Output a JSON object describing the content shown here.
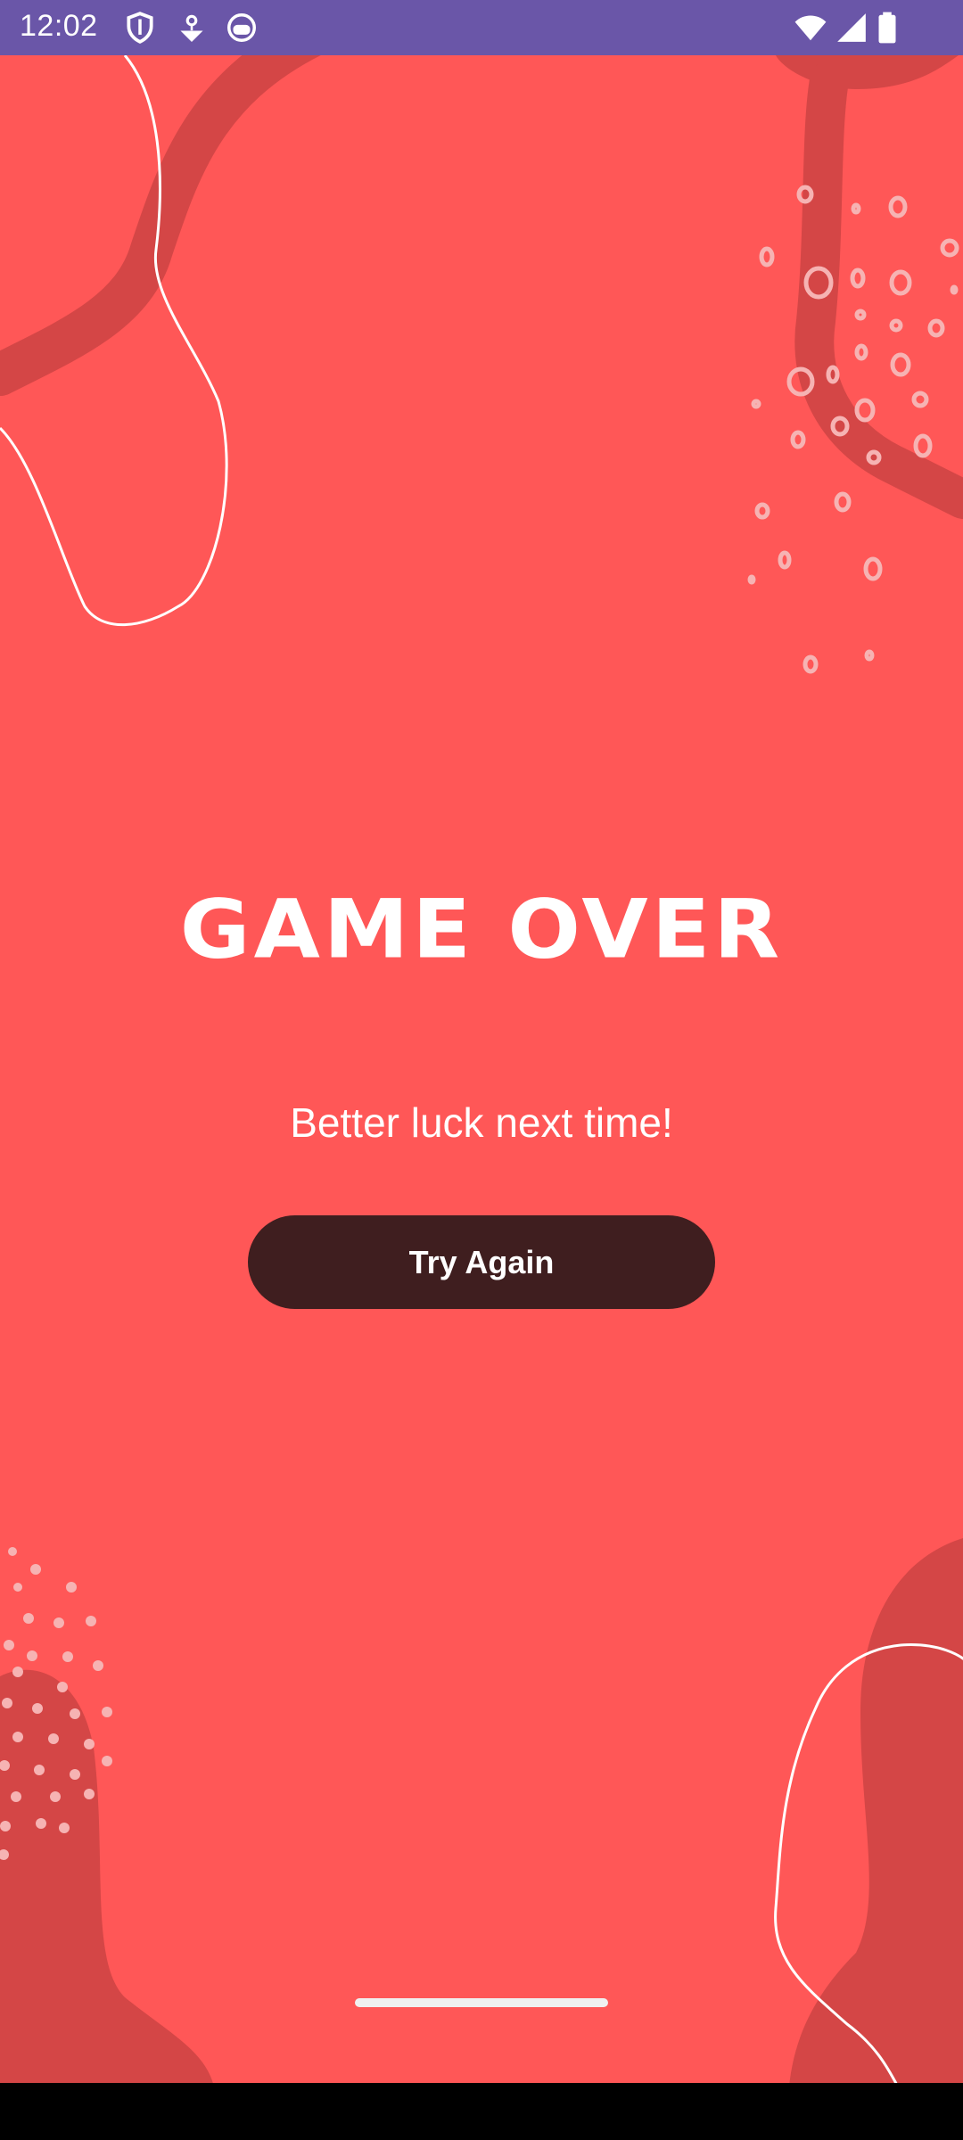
{
  "status_bar": {
    "time": "12:02",
    "icons": [
      "shield-icon",
      "location-pin-icon",
      "face-icon",
      "wifi-icon",
      "signal-icon",
      "battery-icon"
    ],
    "background": "#6a56a8"
  },
  "game": {
    "title": "GAME OVER",
    "message": "Better luck next time!",
    "retry_button_label": "Try Again"
  },
  "colors": {
    "background": "#ff5757",
    "blob": "#d44646",
    "button": "#3f1e1f",
    "text": "#ffffff"
  }
}
